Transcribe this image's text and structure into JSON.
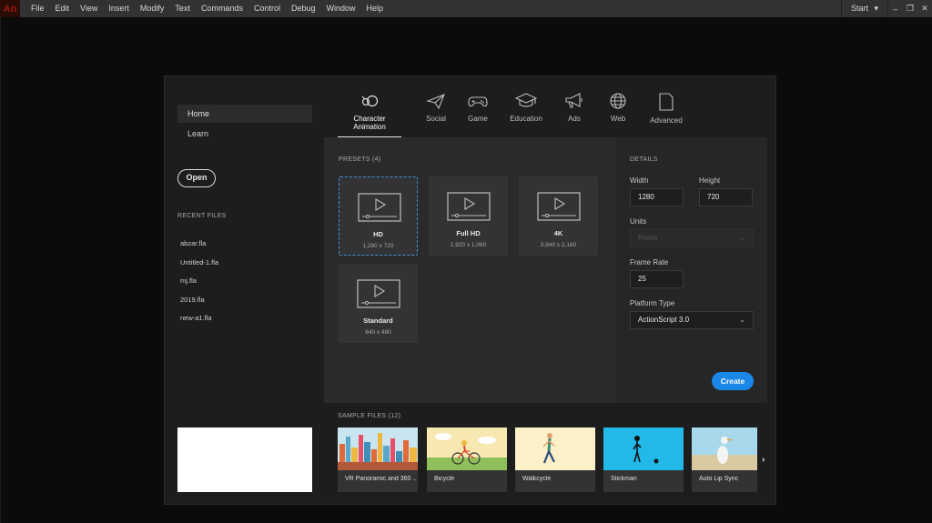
{
  "app": {
    "logo": "An"
  },
  "menu": [
    "File",
    "Edit",
    "View",
    "Insert",
    "Modify",
    "Text",
    "Commands",
    "Control",
    "Debug",
    "Window",
    "Help"
  ],
  "workspace": {
    "label": "Start",
    "chevron": "▾"
  },
  "window_controls": {
    "minimize": "–",
    "restore": "❐",
    "close": "✕"
  },
  "sidebar": {
    "home": "Home",
    "learn": "Learn",
    "open": "Open",
    "recent_title": "RECENT FILES",
    "recent_files": [
      "abzar.fla",
      "Untitled-1.fla",
      "mj.fla",
      "2019.fla",
      "new-a1.fla"
    ]
  },
  "tabs": [
    {
      "label": "Character Animation",
      "icon": "character-animation-icon"
    },
    {
      "label": "Social",
      "icon": "paper-plane-icon"
    },
    {
      "label": "Game",
      "icon": "gamepad-icon"
    },
    {
      "label": "Education",
      "icon": "graduation-cap-icon"
    },
    {
      "label": "Ads",
      "icon": "megaphone-icon"
    },
    {
      "label": "Web",
      "icon": "globe-icon"
    },
    {
      "label": "Advanced",
      "icon": "document-icon"
    }
  ],
  "presets": {
    "title": "PRESETS (4)",
    "items": [
      {
        "name": "HD",
        "size": "1,280 x 720"
      },
      {
        "name": "Full HD",
        "size": "1,920 x 1,080"
      },
      {
        "name": "4K",
        "size": "3,840 x 2,160"
      },
      {
        "name": "Standard",
        "size": "640 x 480"
      }
    ]
  },
  "details": {
    "title": "DETAILS",
    "width_label": "Width",
    "width_value": "1280",
    "height_label": "Height",
    "height_value": "720",
    "units_label": "Units",
    "units_value": "Pixels",
    "frame_rate_label": "Frame Rate",
    "frame_rate_value": "25",
    "platform_label": "Platform Type",
    "platform_value": "ActionScript 3.0",
    "create": "Create"
  },
  "samples": {
    "title": "SAMPLE FILES (12)",
    "items": [
      {
        "name": "VR Panoramic and 360 ..."
      },
      {
        "name": "Bicycle"
      },
      {
        "name": "Walkcycle"
      },
      {
        "name": "Stickman"
      },
      {
        "name": "Auto Lip Sync"
      }
    ],
    "next": "›"
  },
  "colors": {
    "accent": "#1a86e6",
    "selected_border": "#3b8ee0",
    "logo": "#9a1c0c"
  }
}
